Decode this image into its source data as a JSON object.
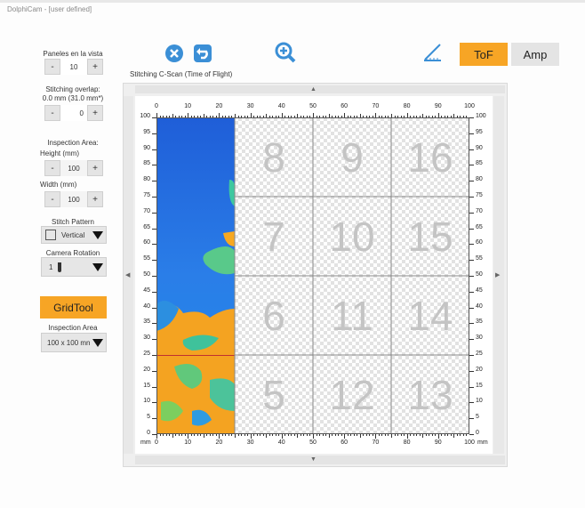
{
  "window": {
    "title": "DolphiCam - [user defined]"
  },
  "left_panel": {
    "panels_label": "Paneles en la vista",
    "panels_value": "10",
    "overlap_label": "Stitching overlap:",
    "overlap_sub": "0.0 mm (31.0 mm*)",
    "overlap_value": "0",
    "inspection_area_label": "Inspection Area:",
    "height_label": "Height (mm)",
    "height_value": "100",
    "width_label": "Width (mm)",
    "width_value": "100",
    "stitch_pattern_label": "Stitch Pattern",
    "stitch_pattern_value": "Vertical",
    "camera_rotation_label": "Camera Rotation",
    "camera_rotation_value": "1",
    "gridtool_label": "GridTool",
    "inspection_area2_label": "Inspection Area",
    "inspection_area2_value": "100 x 100 mn",
    "minus": "-",
    "plus": "+"
  },
  "toolbar": {
    "tof_label": "ToF",
    "amp_label": "Amp",
    "accent": "#f7a525"
  },
  "plot": {
    "title": "Stitching C-Scan (Time of Flight)",
    "x_ticks": [
      "0",
      "10",
      "20",
      "30",
      "40",
      "50",
      "60",
      "70",
      "80",
      "90",
      "100"
    ],
    "x_unit_left": "mm",
    "x_unit_right": "mm",
    "y_ticks": [
      "100",
      "95",
      "90",
      "85",
      "80",
      "75",
      "70",
      "65",
      "60",
      "55",
      "50",
      "45",
      "40",
      "35",
      "30",
      "25",
      "20",
      "15",
      "10",
      "5",
      "0"
    ],
    "panels": [
      {
        "label": "8",
        "col": 1,
        "row": 0
      },
      {
        "label": "9",
        "col": 2,
        "row": 0
      },
      {
        "label": "16",
        "col": 3,
        "row": 0
      },
      {
        "label": "7",
        "col": 1,
        "row": 1
      },
      {
        "label": "10",
        "col": 2,
        "row": 1
      },
      {
        "label": "15",
        "col": 3,
        "row": 1
      },
      {
        "label": "6",
        "col": 1,
        "row": 2
      },
      {
        "label": "11",
        "col": 2,
        "row": 2
      },
      {
        "label": "14",
        "col": 3,
        "row": 2
      },
      {
        "label": "5",
        "col": 1,
        "row": 3
      },
      {
        "label": "12",
        "col": 2,
        "row": 3
      },
      {
        "label": "13",
        "col": 3,
        "row": 3
      }
    ]
  }
}
